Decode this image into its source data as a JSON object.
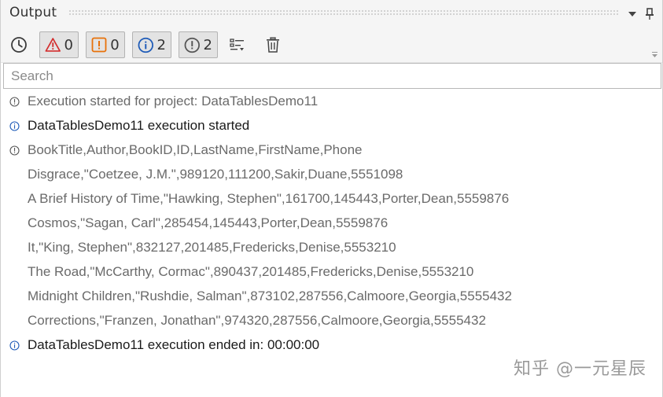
{
  "panel": {
    "title": "Output"
  },
  "toolbar": {
    "errors_count": "0",
    "warnings_count": "0",
    "info_count": "2",
    "trace_count": "2"
  },
  "search": {
    "placeholder": "Search",
    "value": ""
  },
  "log_lines": [
    {
      "icon": "info-circle-icon",
      "text": "Execution started for project: DataTablesDemo11"
    },
    {
      "icon": "info-circle-blue-icon",
      "text": "DataTablesDemo11 execution started"
    },
    {
      "icon": "info-circle-icon",
      "text": "BookTitle,Author,BookID,ID,LastName,FirstName,Phone"
    },
    {
      "icon": "",
      "text": "Disgrace,\"Coetzee, J.M.\",989120,111200,Sakir,Duane,5551098"
    },
    {
      "icon": "",
      "text": "A Brief History of Time,\"Hawking, Stephen\",161700,145443,Porter,Dean,5559876"
    },
    {
      "icon": "",
      "text": "Cosmos,\"Sagan, Carl\",285454,145443,Porter,Dean,5559876"
    },
    {
      "icon": "",
      "text": "It,\"King, Stephen\",832127,201485,Fredericks,Denise,5553210"
    },
    {
      "icon": "",
      "text": "The Road,\"McCarthy, Cormac\",890437,201485,Fredericks,Denise,5553210"
    },
    {
      "icon": "",
      "text": "Midnight Children,\"Rushdie, Salman\",873102,287556,Calmoore,Georgia,5555432"
    },
    {
      "icon": "",
      "text": "Corrections,\"Franzen, Jonathan\",974320,287556,Calmoore,Georgia,5555432"
    },
    {
      "icon": "info-circle-blue-icon",
      "text": "DataTablesDemo11 execution ended in: 00:00:00"
    }
  ],
  "watermark": "知乎 @一元星辰",
  "colors": {
    "error": "#d32f2f",
    "warning": "#e8710a",
    "info": "#1e5bb8",
    "trace": "#555555",
    "toggle_bg": "#e3e3e3"
  }
}
